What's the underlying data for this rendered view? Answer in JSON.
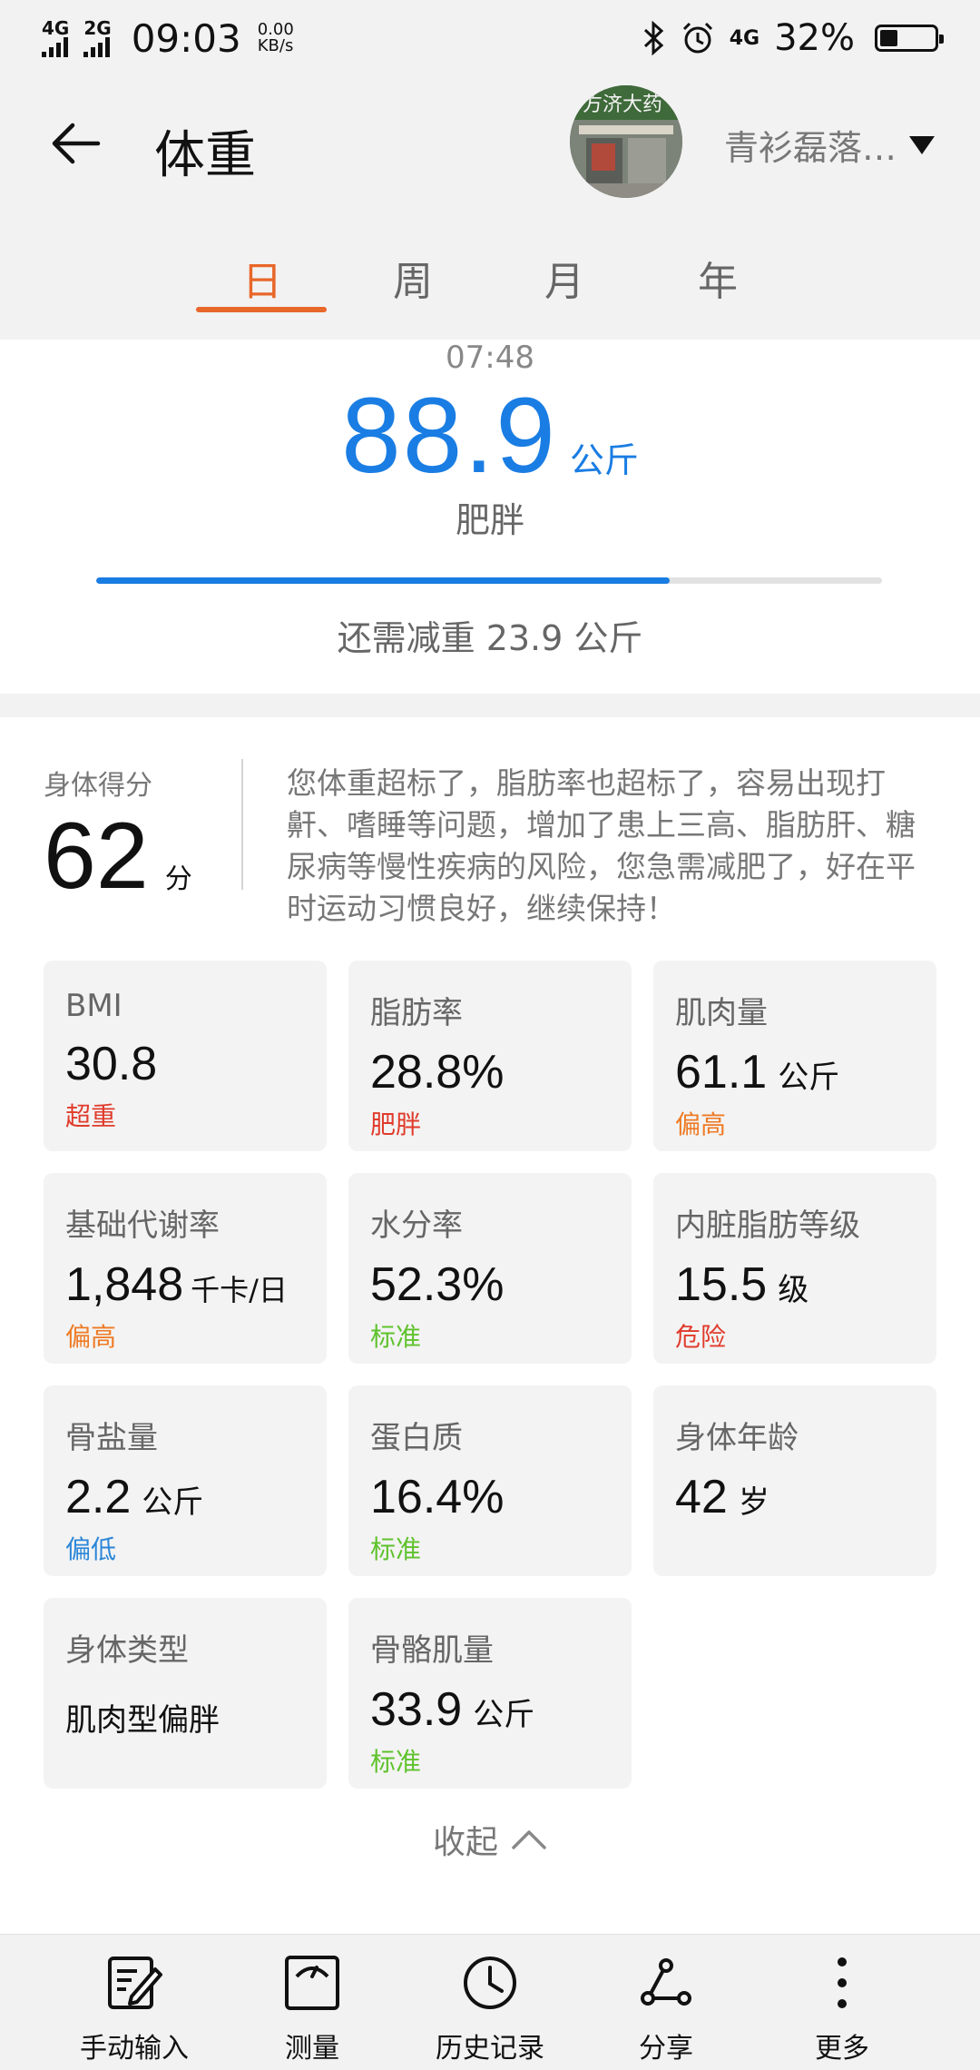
{
  "status_bar": {
    "net1": "4G",
    "net2": "2G",
    "time": "09:03",
    "speed_value": "0.00",
    "speed_unit": "KB/s",
    "net3": "4G",
    "battery": "32%",
    "battery_level": 0.32
  },
  "header": {
    "title": "体重",
    "user_name": "青衫磊落…",
    "back_icon": "arrow-left-icon",
    "avatar_text": "方济大药"
  },
  "tabs": [
    {
      "label": "日",
      "active": true
    },
    {
      "label": "周",
      "active": false
    },
    {
      "label": "月",
      "active": false
    },
    {
      "label": "年",
      "active": false
    }
  ],
  "summary": {
    "time": "07:48",
    "weight": "88.9",
    "unit": "公斤",
    "status": "肥胖",
    "progress_fraction": 0.73,
    "need_text": "还需减重 23.9 公斤"
  },
  "score": {
    "label": "身体得分",
    "value": "62",
    "unit": "分",
    "advice": "您体重超标了，脂肪率也超标了，容易出现打鼾、嗜睡等问题，增加了患上三高、脂肪肝、糖尿病等慢性疾病的风险，您急需减肥了，好在平时运动习惯良好，继续保持！"
  },
  "metrics": [
    {
      "label": "BMI",
      "value": "30.8",
      "unit": "",
      "status": "超重",
      "status_color": "#e03b2b"
    },
    {
      "label": "脂肪率",
      "value": "28.8%",
      "unit": "",
      "status": "肥胖",
      "status_color": "#e03b2b"
    },
    {
      "label": "肌肉量",
      "value": "61.1",
      "unit": "公斤",
      "status": "偏高",
      "status_color": "#ee7a24"
    },
    {
      "label": "基础代谢率",
      "value": "1,848",
      "unit": "千卡/日",
      "status": "偏高",
      "status_color": "#ee7a24"
    },
    {
      "label": "水分率",
      "value": "52.3%",
      "unit": "",
      "status": "标准",
      "status_color": "#5fc22c"
    },
    {
      "label": "内脏脂肪等级",
      "value": "15.5",
      "unit": "级",
      "status": "危险",
      "status_color": "#e03b2b"
    },
    {
      "label": "骨盐量",
      "value": "2.2",
      "unit": "公斤",
      "status": "偏低",
      "status_color": "#2b86d8"
    },
    {
      "label": "蛋白质",
      "value": "16.4%",
      "unit": "",
      "status": "标准",
      "status_color": "#5fc22c"
    },
    {
      "label": "身体年龄",
      "value": "42",
      "unit": "岁",
      "status": "",
      "status_color": ""
    },
    {
      "label": "身体类型",
      "value": "肌肉型偏胖",
      "unit": "",
      "status": "",
      "status_color": "",
      "text_value": true
    },
    {
      "label": "骨骼肌量",
      "value": "33.9",
      "unit": "公斤",
      "status": "标准",
      "status_color": "#5fc22c"
    }
  ],
  "collapse": {
    "label": "收起",
    "icon": "chevron-up-icon"
  },
  "bottom_bar": [
    {
      "label": "手动输入",
      "icon": "edit-icon"
    },
    {
      "label": "测量",
      "icon": "scale-icon"
    },
    {
      "label": "历史记录",
      "icon": "clock-icon"
    },
    {
      "label": "分享",
      "icon": "share-icon"
    },
    {
      "label": "更多",
      "icon": "more-icon"
    }
  ],
  "colors": {
    "accent": "#e8672a",
    "primary_blue": "#1a7de3"
  }
}
